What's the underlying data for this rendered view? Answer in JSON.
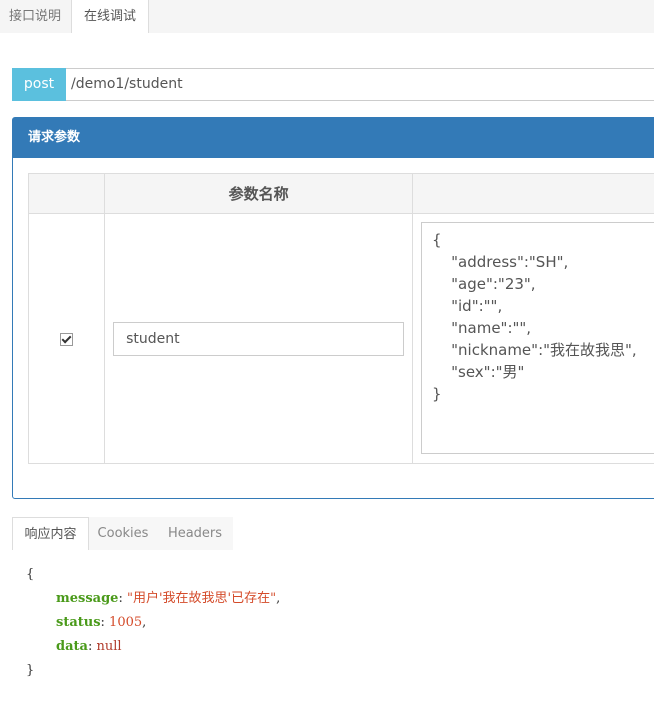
{
  "top_tabs": [
    {
      "label": "接口说明"
    },
    {
      "label": "在线调试"
    }
  ],
  "request": {
    "method": "post",
    "url": "/demo1/student"
  },
  "params_panel": {
    "title": "请求参数",
    "column_header": "参数名称",
    "rows": [
      {
        "checked": true,
        "name": "student",
        "value": "{\n    \"address\":\"SH\",\n    \"age\":\"23\",\n    \"id\":\"\",\n    \"name\":\"\",\n    \"nickname\":\"我在故我思\",\n    \"sex\":\"男\"\n}"
      }
    ]
  },
  "response_tabs": [
    {
      "label": "响应内容"
    },
    {
      "label": "Cookies"
    },
    {
      "label": "Headers"
    }
  ],
  "response": {
    "open_brace": "{",
    "close_brace": "}",
    "fields": [
      {
        "key": "message",
        "value": "\"用户'我在故我思'已存在\"",
        "kind": "string",
        "trail": ","
      },
      {
        "key": "status",
        "value": "1005",
        "kind": "number",
        "trail": ","
      },
      {
        "key": "data",
        "value": "null",
        "kind": "null",
        "trail": ""
      }
    ]
  },
  "colors": {
    "accent": "#337ab7",
    "method_badge": "#5bc0de",
    "json_key": "#4a9a1a",
    "json_string": "#d44b2a"
  }
}
